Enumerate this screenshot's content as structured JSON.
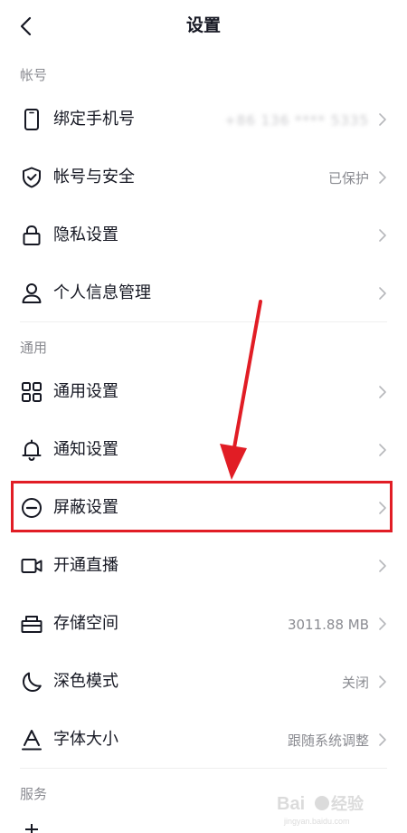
{
  "header": {
    "title": "设置",
    "back_icon": "chevron-left-icon"
  },
  "sections": {
    "account": {
      "label": "帐号",
      "items": [
        {
          "label": "绑定手机号",
          "value": "+86 136 **** 5335",
          "icon": "phone-icon"
        },
        {
          "label": "帐号与安全",
          "value": "已保护",
          "icon": "shield-check-icon"
        },
        {
          "label": "隐私设置",
          "value": "",
          "icon": "lock-icon"
        },
        {
          "label": "个人信息管理",
          "value": "",
          "icon": "person-icon"
        }
      ]
    },
    "general": {
      "label": "通用",
      "items": [
        {
          "label": "通用设置",
          "value": "",
          "icon": "grid-icon"
        },
        {
          "label": "通知设置",
          "value": "",
          "icon": "bell-icon"
        },
        {
          "label": "屏蔽设置",
          "value": "",
          "icon": "block-icon"
        },
        {
          "label": "开通直播",
          "value": "",
          "icon": "video-camera-icon"
        },
        {
          "label": "存储空间",
          "value": "3011.88 MB",
          "icon": "storage-icon"
        },
        {
          "label": "深色模式",
          "value": "关闭",
          "icon": "moon-icon"
        },
        {
          "label": "字体大小",
          "value": "跟随系统调整",
          "icon": "font-size-icon"
        }
      ]
    },
    "service": {
      "label": "服务"
    }
  },
  "annotation": {
    "highlight_color": "#e11d25"
  },
  "watermark": {
    "text": "Bai du 经验",
    "subtext": "jingyan.baidu.com"
  }
}
